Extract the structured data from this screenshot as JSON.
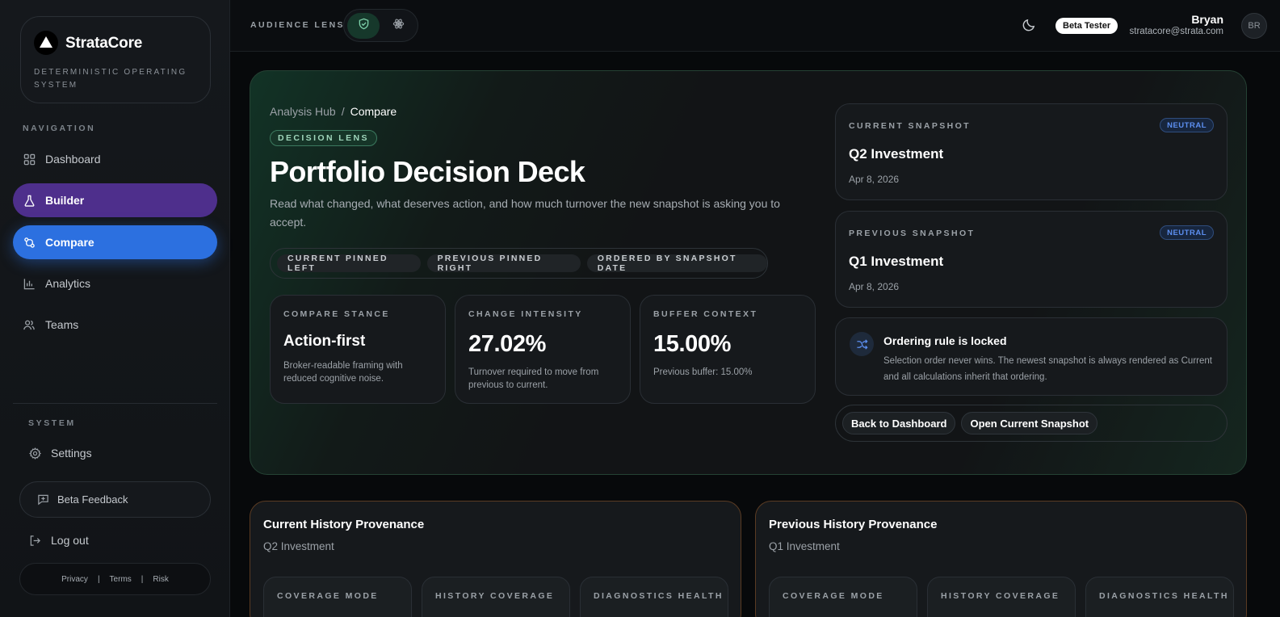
{
  "brand": {
    "name": "StrataCore",
    "subtitle": "DETERMINISTIC OPERATING SYSTEM"
  },
  "sidebar": {
    "nav_heading": "NAVIGATION",
    "items": [
      {
        "label": "Dashboard",
        "icon": "grid-icon"
      },
      {
        "label": "Builder",
        "icon": "flask-icon"
      },
      {
        "label": "Compare",
        "icon": "compare-icon"
      },
      {
        "label": "Analytics",
        "icon": "bar-chart-icon"
      },
      {
        "label": "Teams",
        "icon": "users-icon"
      }
    ],
    "system_heading": "SYSTEM",
    "settings_label": "Settings",
    "feedback_label": "Beta Feedback",
    "logout_label": "Log out",
    "legal": {
      "privacy": "Privacy",
      "sep": "|",
      "terms": "Terms",
      "risk": "Risk"
    }
  },
  "topbar": {
    "lens_label": "AUDIENCE LENS",
    "beta_badge": "Beta Tester",
    "user_name": "Bryan",
    "user_email": "stratacore@strata.com",
    "avatar_initials": "BR"
  },
  "hero": {
    "breadcrumb_root": "Analysis Hub",
    "breadcrumb_sep": "/",
    "breadcrumb_current": "Compare",
    "pill": "DECISION LENS",
    "title": "Portfolio Decision Deck",
    "description": "Read what changed, what deserves action, and how much turnover the new snapshot is asking you to accept.",
    "chips": [
      "CURRENT PINNED LEFT",
      "PREVIOUS PINNED RIGHT",
      "ORDERED BY SNAPSHOT DATE"
    ],
    "stats": [
      {
        "label": "COMPARE STANCE",
        "value": "Action-first",
        "desc": "Broker-readable framing with reduced cognitive noise."
      },
      {
        "label": "CHANGE INTENSITY",
        "value": "27.02%",
        "desc": "Turnover required to move from previous to current."
      },
      {
        "label": "BUFFER CONTEXT",
        "value": "15.00%",
        "desc": "Previous buffer: 15.00%"
      }
    ],
    "current_snapshot": {
      "label": "CURRENT SNAPSHOT",
      "badge": "NEUTRAL",
      "title": "Q2 Investment",
      "date": "Apr 8, 2026"
    },
    "previous_snapshot": {
      "label": "PREVIOUS SNAPSHOT",
      "badge": "NEUTRAL",
      "title": "Q1 Investment",
      "date": "Apr 8, 2026"
    },
    "rule": {
      "title": "Ordering rule is locked",
      "desc": "Selection order never wins. The newest snapshot is always rendered as Current and all calculations inherit that ordering."
    },
    "actions": {
      "back": "Back to Dashboard",
      "open": "Open Current Snapshot"
    }
  },
  "provenance": [
    {
      "title": "Current History Provenance",
      "subtitle": "Q2 Investment",
      "cards": [
        "COVERAGE MODE",
        "HISTORY COVERAGE",
        "DIAGNOSTICS HEALTH"
      ]
    },
    {
      "title": "Previous History Provenance",
      "subtitle": "Q1 Investment",
      "cards": [
        "COVERAGE MODE",
        "HISTORY COVERAGE",
        "DIAGNOSTICS HEALTH"
      ]
    }
  ],
  "colors": {
    "builder_active": "#4e2f8c",
    "compare_active": "#2c70e0",
    "hero_border": "#254234",
    "neutral_badge": "#5c8ff0",
    "provenance_border": "#5a3b23"
  }
}
